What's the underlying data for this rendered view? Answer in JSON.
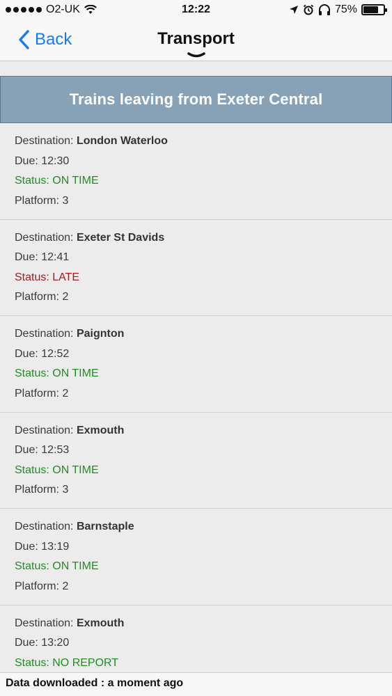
{
  "status_bar": {
    "carrier": "O2-UK",
    "time": "12:22",
    "battery": "75%",
    "battery_level": 0.75
  },
  "nav": {
    "back_label": "Back",
    "title": "Transport"
  },
  "header": {
    "title": "Trains leaving from Exeter Central"
  },
  "labels": {
    "destination": "Destination: ",
    "due": "Due: ",
    "status": "Status: ",
    "platform": "Platform: "
  },
  "trains": [
    {
      "destination": "London Waterloo",
      "due": "12:30",
      "status": "ON TIME",
      "platform": "3"
    },
    {
      "destination": "Exeter St Davids",
      "due": "12:41",
      "status": "LATE",
      "platform": "2"
    },
    {
      "destination": "Paignton",
      "due": "12:52",
      "status": "ON TIME",
      "platform": "2"
    },
    {
      "destination": "Exmouth",
      "due": "12:53",
      "status": "ON TIME",
      "platform": "3"
    },
    {
      "destination": "Barnstaple",
      "due": "13:19",
      "status": "ON TIME",
      "platform": "2"
    },
    {
      "destination": "Exmouth",
      "due": "13:20",
      "status": "NO REPORT",
      "platform": ""
    }
  ],
  "footer": {
    "text": "Data downloaded : a moment ago"
  },
  "colors": {
    "accent": "#1a7ae6",
    "header_bg": "#87a2b6",
    "on_time": "#1e8f1e",
    "late": "#a11c1c"
  }
}
